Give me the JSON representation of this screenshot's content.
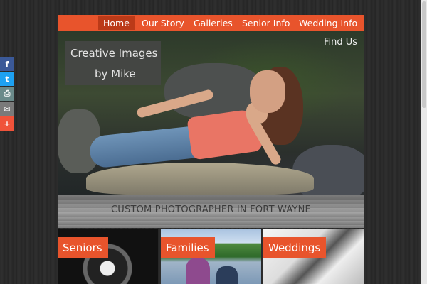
{
  "nav": {
    "items": [
      {
        "label": "Home",
        "active": true
      },
      {
        "label": "Our Story",
        "active": false
      },
      {
        "label": "Galleries",
        "active": false
      },
      {
        "label": "Senior Info",
        "active": false
      },
      {
        "label": "Wedding Info",
        "active": false
      }
    ]
  },
  "hero": {
    "logo_line1": "Creative Images",
    "logo_line2": "by Mike",
    "find_us": "Find Us"
  },
  "tagline": "CUSTOM PHOTOGRAPHER IN FORT WAYNE",
  "tiles": [
    {
      "label": "Seniors"
    },
    {
      "label": "Families"
    },
    {
      "label": "Weddings"
    }
  ],
  "share": {
    "buttons": [
      {
        "icon": "facebook-icon",
        "glyph": "f"
      },
      {
        "icon": "twitter-icon",
        "glyph": "t"
      },
      {
        "icon": "print-icon",
        "glyph": "⎙"
      },
      {
        "icon": "email-icon",
        "glyph": "✉"
      },
      {
        "icon": "plus-icon",
        "glyph": "+"
      }
    ]
  },
  "colors": {
    "accent": "#e8542c",
    "nav_active": "#bb3a18"
  }
}
